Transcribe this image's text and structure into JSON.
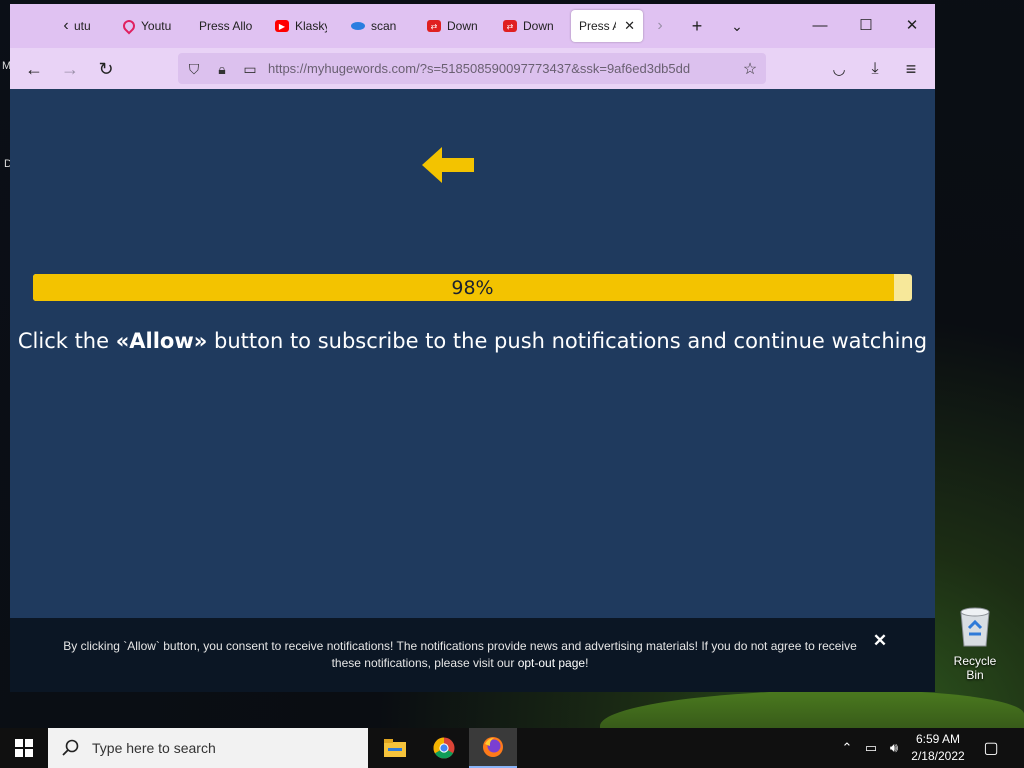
{
  "desktop": {
    "stray_letters": [
      "M",
      "D"
    ],
    "recycle_bin_label": "Recycle Bin"
  },
  "browser": {
    "tabs": [
      {
        "title": "utu",
        "icon": "chevron-left-icon"
      },
      {
        "title": "Youtu",
        "icon": "location-pin-icon"
      },
      {
        "title": "Press Allo",
        "icon": ""
      },
      {
        "title": "Klasky",
        "icon": "youtube-icon"
      },
      {
        "title": "scan",
        "icon": "scan-icon"
      },
      {
        "title": "Down",
        "icon": "download-site-icon"
      },
      {
        "title": "Down",
        "icon": "download-site-icon"
      },
      {
        "title": "Press Al",
        "icon": "",
        "active": true
      }
    ],
    "url": "https://myhugewords.com/?s=518508590097773437&ssk=9af6ed3db5dd",
    "accent": "#e0c2f2"
  },
  "page": {
    "progress_value": 0.98,
    "progress_label": "98%",
    "headline_prefix": "Click the ",
    "headline_bold": "«Allow»",
    "headline_suffix": " button to subscribe to the push notifications and continue watching",
    "consent_text": "By clicking `Allow` button, you consent to receive notifications! The notifications provide news and advertising materials! If you do not agree to receive these notifications, please visit our ",
    "consent_link": "opt-out page",
    "consent_end": "!",
    "colors": {
      "background": "#1f3a5e",
      "progress": "#f3c300",
      "arrow": "#f3c300"
    }
  },
  "taskbar": {
    "search_placeholder": "Type here to search",
    "time": "6:59 AM",
    "date": "2/18/2022"
  }
}
